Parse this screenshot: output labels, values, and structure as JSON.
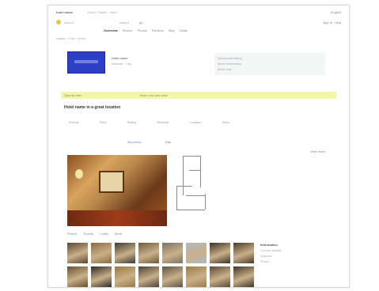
{
  "topbar": {
    "site_name": "hotel name",
    "links": "travel · hotels · more",
    "lang": "English"
  },
  "nav": {
    "search": "search",
    "field": "search",
    "go": "go",
    "right": "sign in · help"
  },
  "tabs": [
    {
      "label": "Overview"
    },
    {
      "label": "Rooms"
    },
    {
      "label": "Photos"
    },
    {
      "label": "Reviews"
    },
    {
      "label": "Map"
    },
    {
      "label": "Deals"
    }
  ],
  "breadcrumb": "Hotels > City > Hotel",
  "hotel": {
    "name": "Hotel name",
    "sub": "Address · City"
  },
  "ad_lines": [
    "Sponsored listing",
    "More information",
    "Book now"
  ],
  "yellow_bar": {
    "text1": "Special offer",
    "text2": "Book now and save"
  },
  "title": "Hotel name in a great location",
  "specs": [
    "Rooms",
    "Price",
    "Rating",
    "Reviews",
    "Location",
    "More"
  ],
  "photo_links": [
    "All photos",
    "Map"
  ],
  "right_link": "View more",
  "photo_tabs": [
    "Photos",
    "Rooms",
    "Lobby",
    "More"
  ],
  "thumbs": [
    "#5a4632",
    "#8b6a3e",
    "#3e3a32",
    "#6e5b3a",
    "#7a7366",
    "#b0b8c4",
    "#3a3226",
    "#4a3a2a",
    "#6a5030",
    "#2e2a26",
    "#9c7a3e",
    "#4a4038",
    "#5e5446",
    "#a07a48",
    "#5a4a3a",
    "#3e342a"
  ],
  "side_panel": {
    "heading": "Information",
    "lines": [
      "Contact details",
      "Address",
      "Phone"
    ]
  }
}
